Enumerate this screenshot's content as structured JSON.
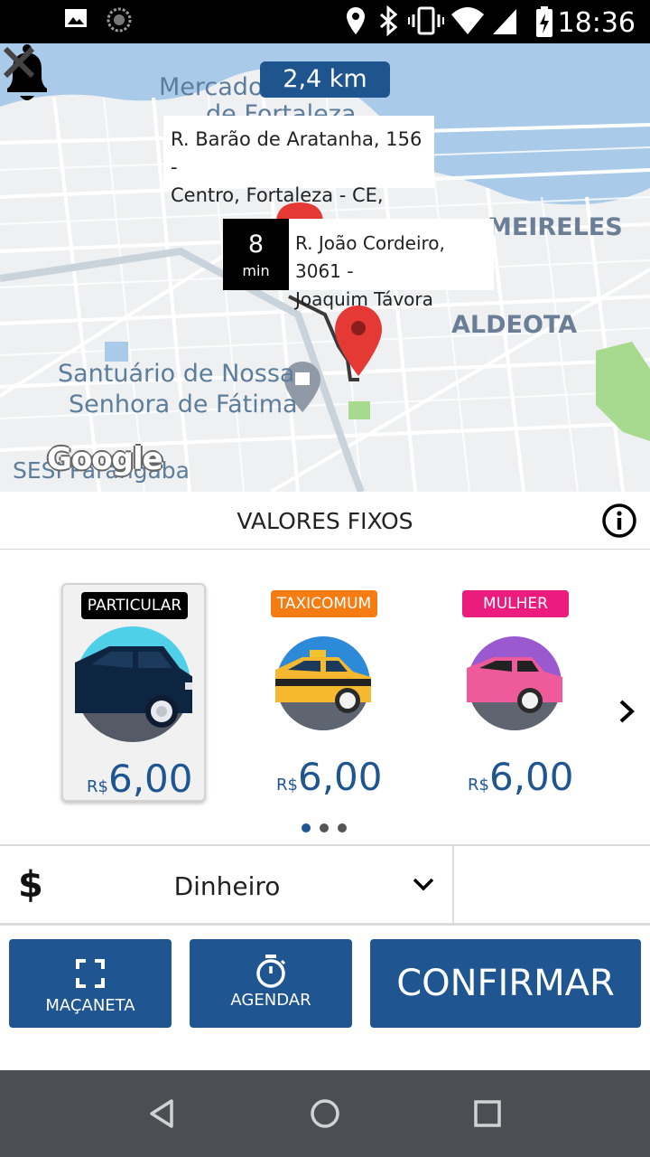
{
  "status_bar": {
    "time": "18:36",
    "icons": [
      "image-icon",
      "sync-icon",
      "location-icon",
      "bluetooth-icon",
      "vibrate-icon",
      "wifi-icon",
      "signal-icon",
      "battery-icon"
    ]
  },
  "map": {
    "distance": "2,4 km",
    "labels": {
      "mercado": "Mercado",
      "fortaleza": "de Fortaleza",
      "meireles": "MEIRELES",
      "aldeota": "ALDEOTA",
      "santuario1": "Santuário de Nossa",
      "santuario2": "Senhora de Fátima",
      "sesi": "SESI Parangaba"
    },
    "origin_address": {
      "line1": "R. Barão de Aratanha, 156 -",
      "line2": "Centro, Fortaleza - CE,"
    },
    "destination": {
      "eta_value": "8",
      "eta_unit": "min",
      "line1": "R. João Cordeiro, 3061 -",
      "line2": "Joaquim Távora"
    },
    "watermark": "Google"
  },
  "section": {
    "title": "VALORES FIXOS"
  },
  "cars": [
    {
      "tag": "PARTICULAR",
      "tag_color": "#000000",
      "currency": "R$",
      "price": "6,00",
      "selected": true,
      "icon": "dark-car-icon"
    },
    {
      "tag": "TAXICOMUM",
      "tag_color": "#f57c12",
      "currency": "R$",
      "price": "6,00",
      "selected": false,
      "icon": "taxi-car-icon"
    },
    {
      "tag": "MULHER",
      "tag_color": "#ec1b7e",
      "currency": "R$",
      "price": "6,00",
      "selected": false,
      "icon": "pink-car-icon"
    }
  ],
  "pagination": {
    "pages": 3,
    "active": 1
  },
  "payment": {
    "symbol": "$",
    "method": "Dinheiro"
  },
  "actions": {
    "macaneta": "MAÇANETA",
    "agendar": "AGENDAR",
    "confirmar": "CONFIRMAR"
  },
  "colors": {
    "primary": "#1f5590",
    "pin_red": "#e53935"
  }
}
